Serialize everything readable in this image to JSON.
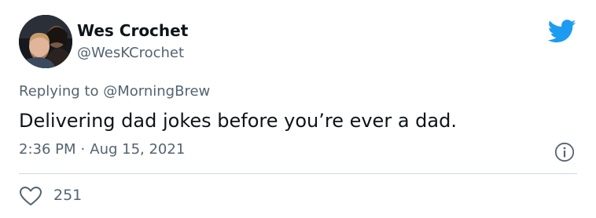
{
  "tweet": {
    "display_name": "Wes Crochet",
    "handle": "@WesKCrochet",
    "replying_to_label": "Replying to",
    "replying_to_handle": "@MorningBrew",
    "text": "Delivering dad jokes before you’re ever a dad.",
    "time": "2:36 PM",
    "separator": "·",
    "date": "Aug 15, 2021",
    "likes": "251"
  },
  "icons": {
    "brand": "twitter-bird-icon",
    "info": "info-icon",
    "like": "heart-icon",
    "avatar": "profile-photo"
  },
  "colors": {
    "brand": "#1d9bf0",
    "text_primary": "#0f1419",
    "text_secondary": "#536471",
    "divider": "#cfd9de"
  }
}
